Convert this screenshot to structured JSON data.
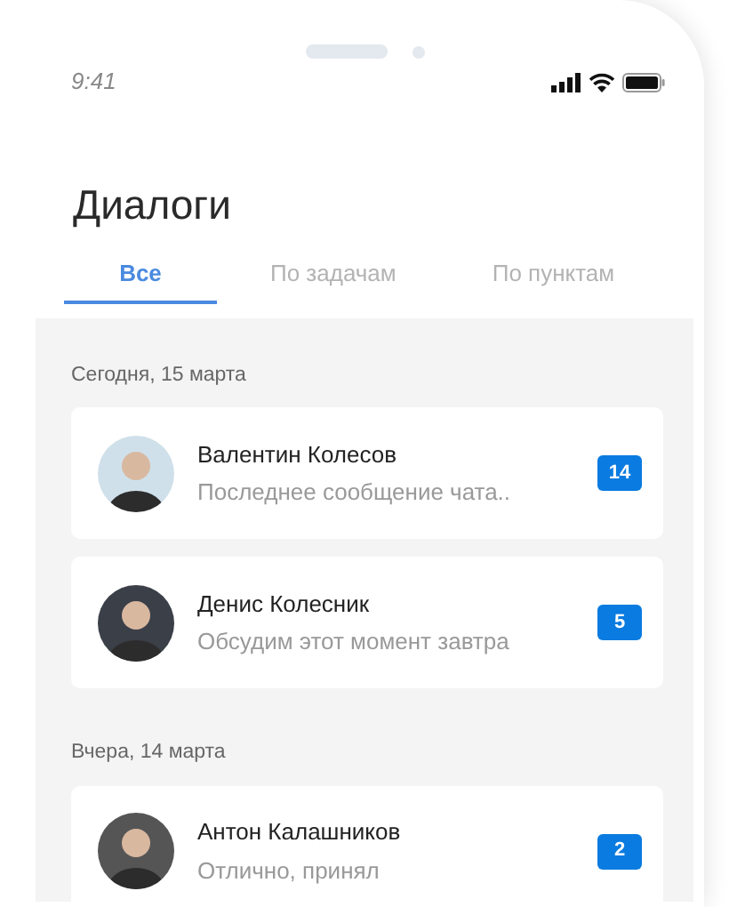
{
  "status_bar": {
    "time": "9:41"
  },
  "title": "Диалоги",
  "tabs": [
    {
      "label": "Все",
      "selected": true
    },
    {
      "label": "По задачам",
      "selected": false
    },
    {
      "label": "По пунктам",
      "selected": false
    }
  ],
  "sections": [
    {
      "date": "Сегодня, 15 марта",
      "dialogs": [
        {
          "name": "Валентин Колесов",
          "message": "Последнее сообщение чата..",
          "unread": "14"
        },
        {
          "name": "Денис Колесник",
          "message": "Обсудим этот момент завтра",
          "unread": "5"
        }
      ]
    },
    {
      "date": "Вчера, 14 марта",
      "dialogs": [
        {
          "name": "Антон Калашников",
          "message": "Отлично, принял",
          "unread": "2"
        }
      ]
    }
  ]
}
